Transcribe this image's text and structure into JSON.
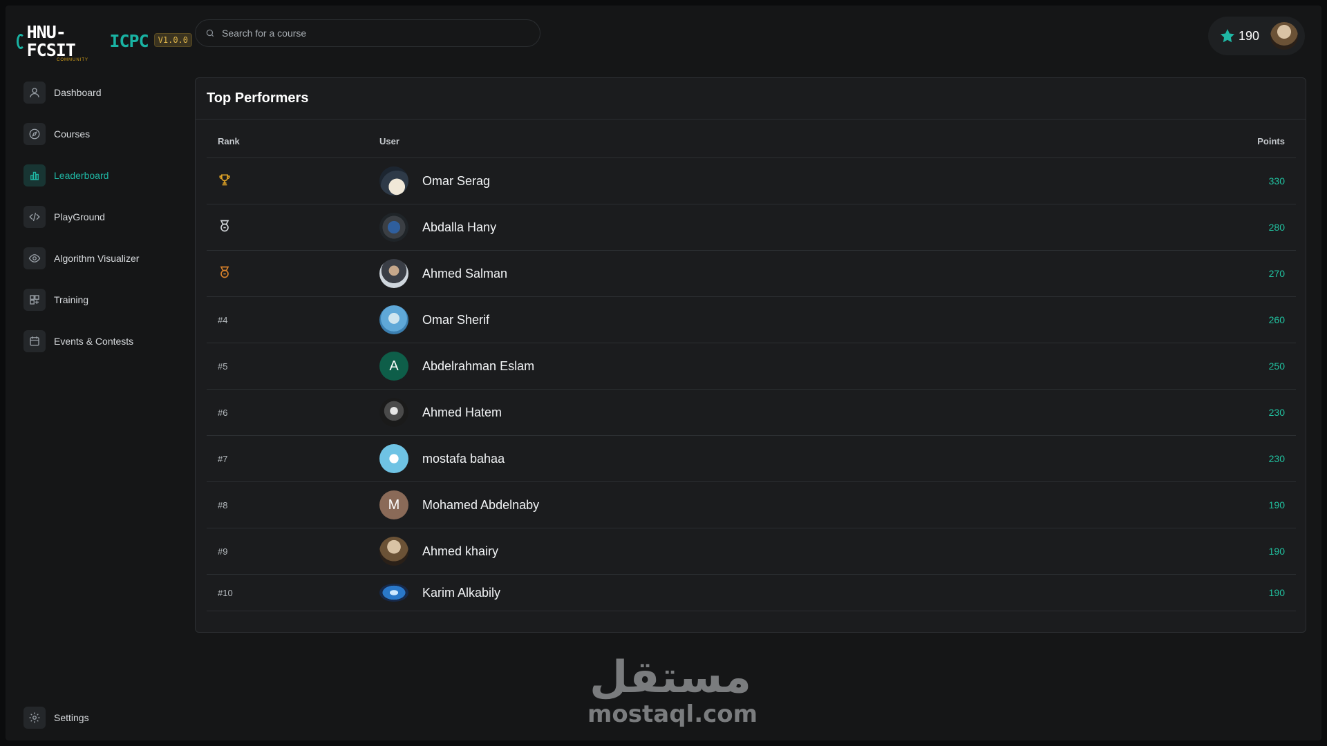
{
  "brand": {
    "logo_main": "HNU-FCSIT",
    "logo_accent": "ICPC",
    "logo_sub": "COMMUNITY",
    "version": "V1.0.0"
  },
  "sidebar": {
    "items": [
      {
        "label": "Dashboard",
        "icon": "user-icon",
        "active": false
      },
      {
        "label": "Courses",
        "icon": "compass-icon",
        "active": false
      },
      {
        "label": "Leaderboard",
        "icon": "bar-chart-icon",
        "active": true
      },
      {
        "label": "PlayGround",
        "icon": "code-icon",
        "active": false
      },
      {
        "label": "Algorithm Visualizer",
        "icon": "eye-icon",
        "active": false
      },
      {
        "label": "Training",
        "icon": "grid-icon",
        "active": false
      },
      {
        "label": "Events & Contests",
        "icon": "calendar-icon",
        "active": false
      }
    ],
    "settings_label": "Settings"
  },
  "header": {
    "search_placeholder": "Search for a course",
    "user_points": "190"
  },
  "leaderboard": {
    "title": "Top Performers",
    "columns": {
      "rank": "Rank",
      "user": "User",
      "points": "Points"
    },
    "rows": [
      {
        "rank": "",
        "rank_icon": "trophy-icon",
        "name": "Omar Serag",
        "points": "330",
        "initial": ""
      },
      {
        "rank": "",
        "rank_icon": "silver-medal-icon",
        "name": "Abdalla Hany",
        "points": "280",
        "initial": ""
      },
      {
        "rank": "",
        "rank_icon": "bronze-medal-icon",
        "name": "Ahmed Salman",
        "points": "270",
        "initial": ""
      },
      {
        "rank": "#4",
        "rank_icon": "",
        "name": "Omar Sherif",
        "points": "260",
        "initial": ""
      },
      {
        "rank": "#5",
        "rank_icon": "",
        "name": "Abdelrahman Eslam",
        "points": "250",
        "initial": "A"
      },
      {
        "rank": "#6",
        "rank_icon": "",
        "name": "Ahmed Hatem",
        "points": "230",
        "initial": ""
      },
      {
        "rank": "#7",
        "rank_icon": "",
        "name": "mostafa bahaa",
        "points": "230",
        "initial": ""
      },
      {
        "rank": "#8",
        "rank_icon": "",
        "name": "Mohamed Abdelnaby",
        "points": "190",
        "initial": "M"
      },
      {
        "rank": "#9",
        "rank_icon": "",
        "name": "Ahmed khairy",
        "points": "190",
        "initial": ""
      },
      {
        "rank": "#10",
        "rank_icon": "",
        "name": "Karim Alkabily",
        "points": "190",
        "initial": ""
      }
    ]
  },
  "watermark": {
    "arabic": "مستقل",
    "latin": "mostaql.com"
  },
  "colors": {
    "accent": "#1fb7a4",
    "points": "#21c2a0",
    "gold": "#e0a326",
    "silver": "#cfd3d7",
    "bronze": "#d9822b"
  }
}
